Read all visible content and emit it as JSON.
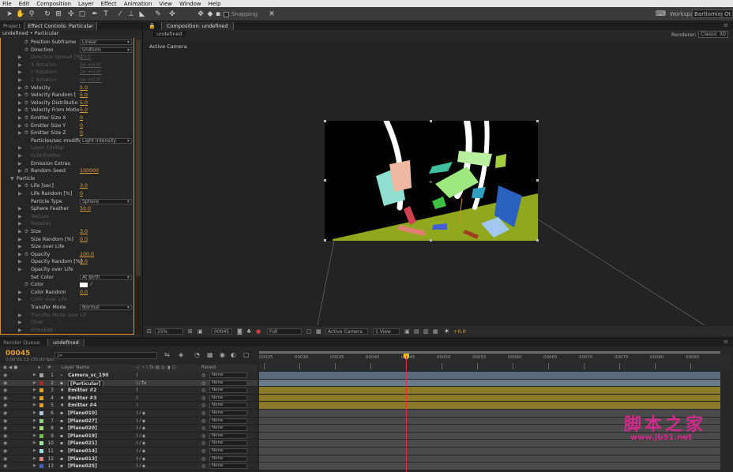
{
  "menu": [
    "File",
    "Edit",
    "Composition",
    "Layer",
    "Effect",
    "Animation",
    "View",
    "Window",
    "Help"
  ],
  "toolbar": {
    "snapping_label": "Snapping",
    "workspace_label": "Workspace:",
    "workspace_value": "Bartlomiej Ot"
  },
  "left_panel": {
    "tabs": [
      "Project",
      "Effect Controls: Particular"
    ],
    "subheader": "undefined • Particular",
    "rows": [
      {
        "label": "Position Subframe",
        "dropdown": "Linear",
        "indent": 2,
        "stopwatch": true
      },
      {
        "label": "Direction",
        "dropdown": "Uniform",
        "indent": 2,
        "stopwatch": true
      },
      {
        "label": "Direction Spread [%]",
        "value": "20.0",
        "indent": 2,
        "dim": true,
        "triangle": true
      },
      {
        "label": "X Rotation",
        "value": "0x +0.0°",
        "indent": 2,
        "dim": true,
        "triangle": true
      },
      {
        "label": "Y Rotation",
        "value": "0x +0.0°",
        "indent": 2,
        "dim": true,
        "triangle": true
      },
      {
        "label": "Z Rotation",
        "value": "0x +0.0°",
        "indent": 2,
        "dim": true,
        "triangle": true
      },
      {
        "label": "Velocity",
        "value": "5.0",
        "indent": 2,
        "stopwatch": true,
        "triangle": true
      },
      {
        "label": "Velocity Random [",
        "value": "5.0",
        "indent": 2,
        "stopwatch": true,
        "triangle": true
      },
      {
        "label": "Velocity Distributio",
        "value": "5.0",
        "indent": 2,
        "stopwatch": true,
        "triangle": true
      },
      {
        "label": "Velocity From Motio",
        "value": "5.0",
        "indent": 2,
        "stopwatch": true,
        "triangle": true
      },
      {
        "label": "Emitter Size X",
        "value": "0",
        "indent": 2,
        "stopwatch": true,
        "triangle": true
      },
      {
        "label": "Emitter Size Y",
        "value": "0",
        "indent": 2,
        "stopwatch": true,
        "triangle": true
      },
      {
        "label": "Emitter Size Z",
        "value": "0",
        "indent": 2,
        "stopwatch": true,
        "triangle": true
      },
      {
        "label": "Particles/sec modifier",
        "dropdown": "Light Intensity",
        "indent": 2
      },
      {
        "label": "Layer Emitter",
        "indent": 2,
        "dim": true,
        "triangle": true
      },
      {
        "label": "Grid Emitter",
        "indent": 2,
        "dim": true,
        "triangle": true
      },
      {
        "label": "Emission Extras",
        "indent": 2,
        "triangle": true
      },
      {
        "label": "Random Seed",
        "value": "100000",
        "indent": 2,
        "stopwatch": true,
        "triangle": true
      },
      {
        "label": "Particle",
        "indent": 1,
        "triangle": true,
        "open": true
      },
      {
        "label": "Life [sec]",
        "value": "3.0",
        "indent": 2,
        "stopwatch": true,
        "triangle": true
      },
      {
        "label": "Life Random [%]",
        "value": "0",
        "indent": 2,
        "triangle": true
      },
      {
        "label": "Particle Type",
        "dropdown": "Sphere",
        "indent": 2
      },
      {
        "label": "Sphere Feather",
        "value": "50.0",
        "indent": 2,
        "triangle": true
      },
      {
        "label": "Texture",
        "indent": 2,
        "dim": true,
        "triangle": true
      },
      {
        "label": "Rotation",
        "indent": 2,
        "dim": true,
        "triangle": true
      },
      {
        "label": "Size",
        "value": "3.0",
        "indent": 2,
        "stopwatch": true,
        "triangle": true
      },
      {
        "label": "Size Random [%]",
        "value": "0.0",
        "indent": 2,
        "triangle": true
      },
      {
        "label": "Size over Life",
        "indent": 2,
        "triangle": true
      },
      {
        "label": "Opacity",
        "value": "100.0",
        "indent": 2,
        "stopwatch": true,
        "triangle": true
      },
      {
        "label": "Opacity Random [%]",
        "value": "0.0",
        "indent": 2,
        "triangle": true
      },
      {
        "label": "Opacity over Life",
        "indent": 2,
        "triangle": true
      },
      {
        "label": "Set Color",
        "dropdown": "At Birth",
        "indent": 2
      },
      {
        "label": "Color",
        "swatch": true,
        "indent": 2,
        "stopwatch": true
      },
      {
        "label": "Color Random",
        "value": "0.0",
        "indent": 2,
        "triangle": true
      },
      {
        "label": "Color over Life",
        "indent": 2,
        "dim": true,
        "triangle": true
      },
      {
        "label": "Transfer Mode",
        "dropdown": "Normal",
        "indent": 2
      },
      {
        "label": "Transfer Mode over Lif",
        "indent": 2,
        "dim": true,
        "triangle": true
      },
      {
        "label": "Glow",
        "indent": 2,
        "dim": true,
        "triangle": true
      },
      {
        "label": "Streaklet",
        "indent": 2,
        "dim": true,
        "triangle": true
      }
    ]
  },
  "composition": {
    "tab": "Composition: undefined",
    "chip": "undefined",
    "renderer_label": "Renderer:",
    "renderer_value": "Classic 3D",
    "view_label": "Active Camera",
    "controls": {
      "zoom": "25%",
      "timecode": "00045",
      "resolution": "Full",
      "camera": "Active Camera",
      "views": "1 View",
      "exposure": "+0.0"
    }
  },
  "timeline": {
    "tabs": [
      "Render Queue",
      "undefined"
    ],
    "timecode": "00045",
    "fps": "0:00:01:15 (30.00 fps)",
    "search_placeholder": "ρ▾",
    "col_layer_name": "Layer Name",
    "col_parent": "Parent",
    "ruler_ticks": [
      "00025",
      "00030",
      "00035",
      "00040",
      "00045",
      "00050",
      "00055",
      "00060",
      "00065",
      "00070",
      "00075",
      "00080",
      "00085"
    ],
    "current_frame": 45,
    "layers": [
      {
        "num": "1",
        "name": "Camera_sc_190",
        "color": "#a5a5a5",
        "parent": "None",
        "bar": "#5a6a7a"
      },
      {
        "num": "2",
        "name": "[Particular]",
        "color": "#a52a2a",
        "parent": "None",
        "bar": "#6a7c8c"
      },
      {
        "num": "3",
        "name": "Emitter #2",
        "color": "#e0a020",
        "parent": "None",
        "bar": "#8a7a2a"
      },
      {
        "num": "4",
        "name": "Emitter #3",
        "color": "#e0a020",
        "parent": "None",
        "bar": "#8a7a2a"
      },
      {
        "num": "5",
        "name": "Emitter #4",
        "color": "#e0a020",
        "parent": "None",
        "bar": "#8a7a2a"
      },
      {
        "num": "6",
        "name": "[Plane010]",
        "color": "#b0c0e0",
        "parent": "None",
        "bar": "#4a4a4a"
      },
      {
        "num": "7",
        "name": "[Plane027]",
        "color": "#90d080",
        "parent": "None",
        "bar": "#4a4a4a"
      },
      {
        "num": "8",
        "name": "[Plane020]",
        "color": "#a0e070",
        "parent": "None",
        "bar": "#4a4a4a"
      },
      {
        "num": "9",
        "name": "[Plane019]",
        "color": "#70c050",
        "parent": "None",
        "bar": "#4a4a4a"
      },
      {
        "num": "10",
        "name": "[Plane021]",
        "color": "#a0e0a0",
        "parent": "None",
        "bar": "#4a4a4a"
      },
      {
        "num": "11",
        "name": "[Plane014]",
        "color": "#a0e0e0",
        "parent": "None",
        "bar": "#4a4a4a"
      },
      {
        "num": "12",
        "name": "[Plane013]",
        "color": "#e08080",
        "parent": "None",
        "bar": "#4a4a4a"
      },
      {
        "num": "13",
        "name": "[Plane025]",
        "color": "#4060c0",
        "parent": "None",
        "bar": "#4a4a4a"
      }
    ]
  },
  "watermark": {
    "text": "脚本之家",
    "url": "www.jb51.net"
  }
}
